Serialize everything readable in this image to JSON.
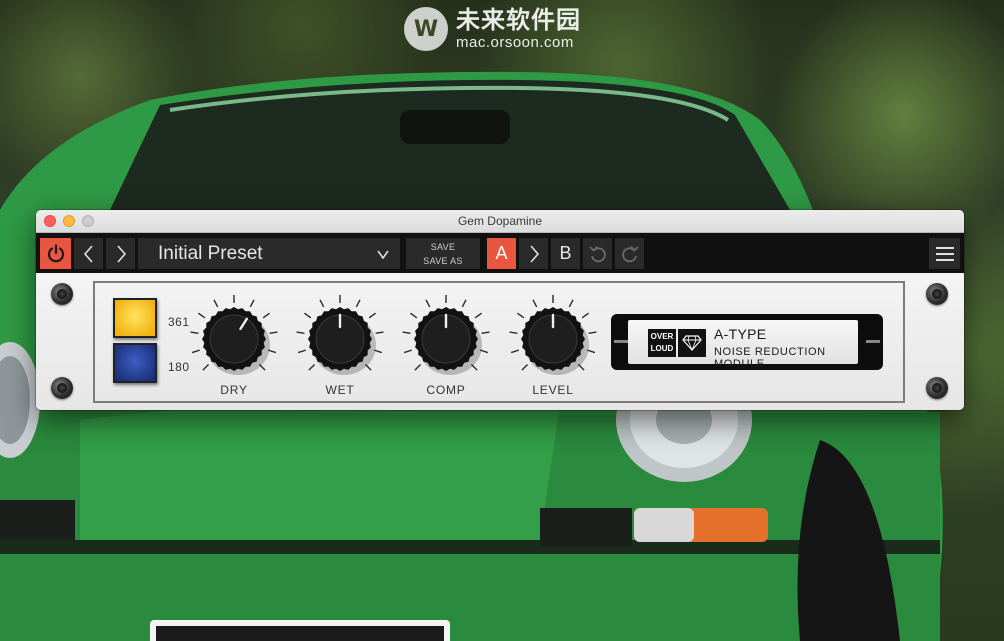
{
  "watermark": {
    "logo_glyph": "W",
    "brand_cn": "未来软件园",
    "url": "mac.orsoon.com"
  },
  "window": {
    "title": "Gem Dopamine"
  },
  "toolbar": {
    "preset_name": "Initial Preset",
    "save_label": "SAVE",
    "save_as_label": "SAVE AS",
    "slot_a": "A",
    "slot_b": "B",
    "active_slot": "A"
  },
  "panel": {
    "selector_labels": [
      "361",
      "180"
    ],
    "knobs": [
      {
        "label": "DRY",
        "value": 0.62
      },
      {
        "label": "WET",
        "value": 0.5
      },
      {
        "label": "COMP",
        "value": 0.5
      },
      {
        "label": "LEVEL",
        "value": 0.5
      }
    ],
    "nameplate": {
      "logo_line1": "OVER",
      "logo_line2": "LOUD",
      "type": "A-TYPE",
      "subtitle": "NOISE REDUCTION MODULE"
    }
  },
  "icons": [
    "power-icon",
    "chevron-left-icon",
    "chevron-right-icon",
    "chevron-down-icon",
    "undo-icon",
    "redo-icon",
    "hamburger-menu-icon",
    "diamond-icon"
  ],
  "colors": {
    "accent": "#e9553f",
    "toolbar_bg": "#111111",
    "button_bg": "#2a2a2a",
    "panel_bg": "#ececec"
  }
}
